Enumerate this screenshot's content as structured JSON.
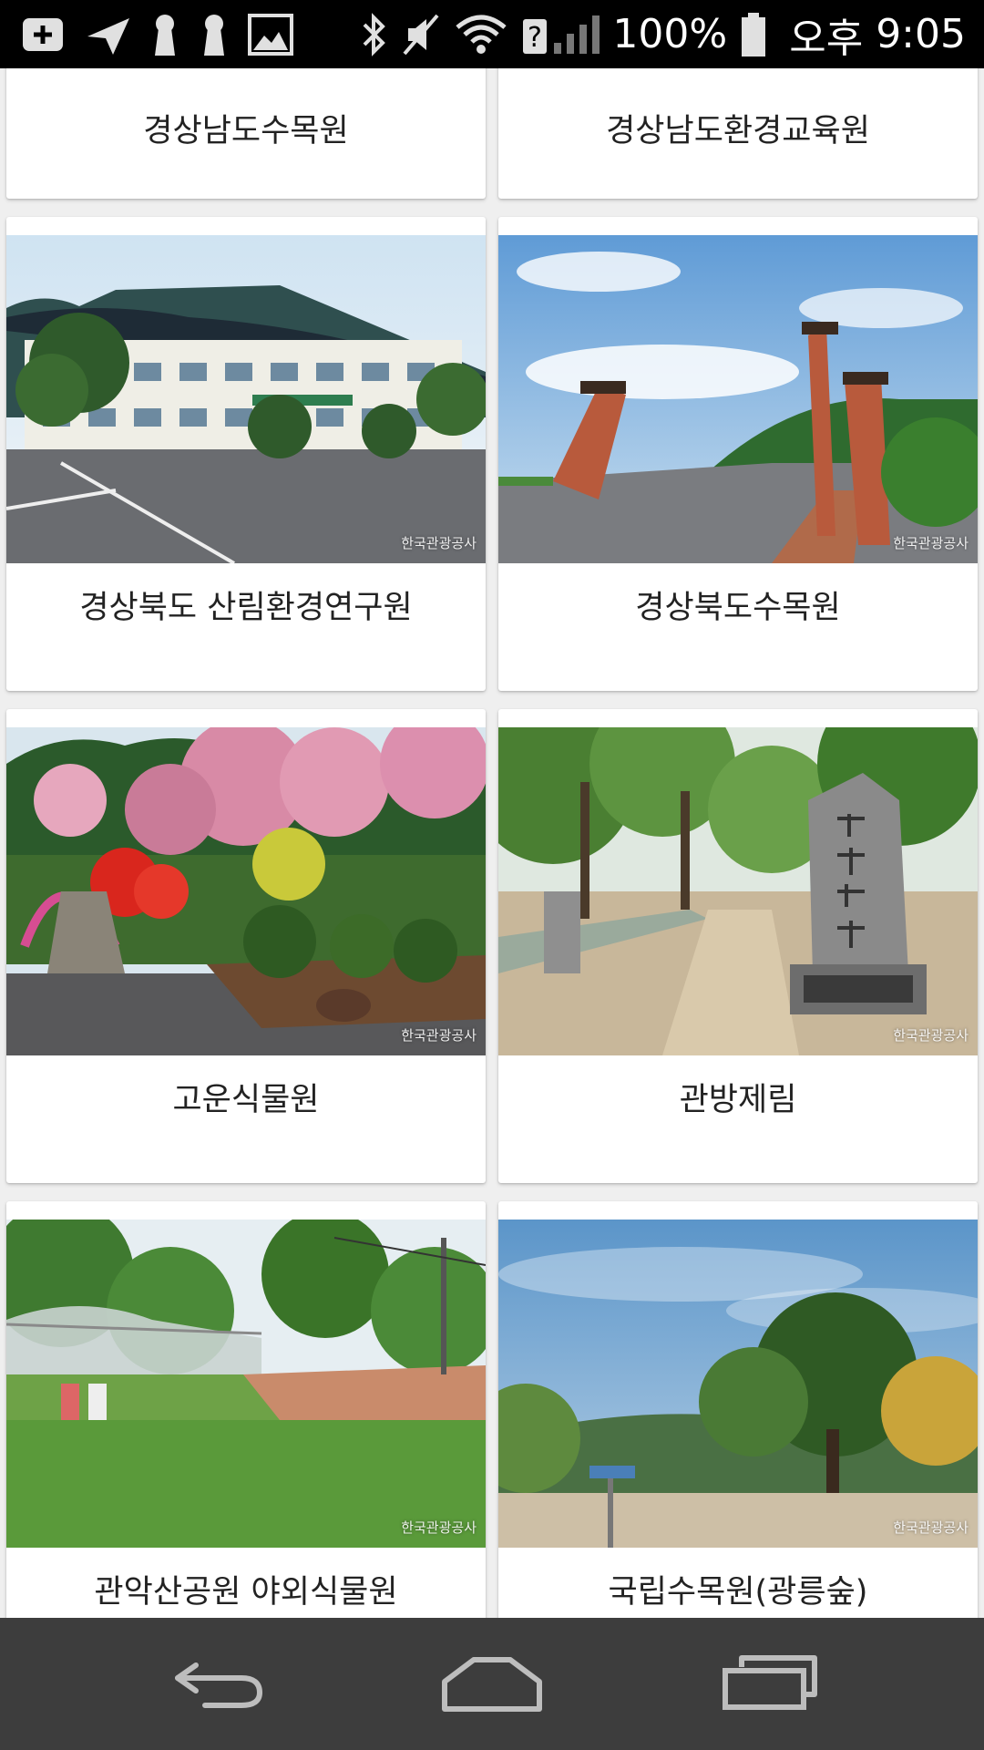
{
  "status_bar": {
    "battery_text": "100%",
    "ampm": "오후",
    "time": "9:05",
    "left_icons": [
      "add-notification-icon",
      "send-icon",
      "keyhole-icon",
      "keyhole-icon",
      "image-icon"
    ],
    "right_icons": [
      "bluetooth-icon",
      "mute-icon",
      "wifi-icon",
      "signal-unknown-icon",
      "battery-icon"
    ]
  },
  "cards": [
    {
      "title": "경상남도수목원"
    },
    {
      "title": "경상남도환경교육원"
    },
    {
      "title": "경상북도 산림환경연구원",
      "watermark": "한국관광공사"
    },
    {
      "title": "경상북도수목원",
      "watermark": "한국관광공사"
    },
    {
      "title": "고운식물원",
      "watermark": "한국관광공사"
    },
    {
      "title": "관방제림",
      "watermark": "한국관광공사"
    },
    {
      "title": "관악산공원 야외식물원",
      "watermark": "한국관광공사"
    },
    {
      "title": "국립수목원(광릉숲)",
      "watermark": "한국관광공사"
    }
  ],
  "nav": {
    "buttons": [
      "back",
      "home",
      "recent-apps"
    ]
  },
  "colors": {
    "status_bar_bg": "#000000",
    "nav_bar_bg": "#3d3d3d",
    "page_bg": "#efefef"
  }
}
